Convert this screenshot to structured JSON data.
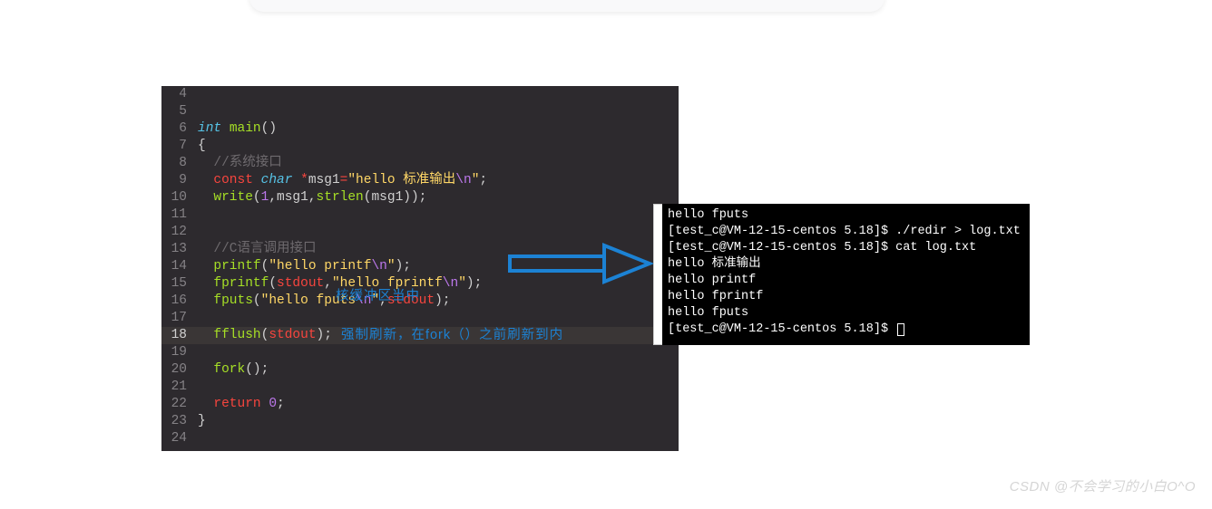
{
  "code": {
    "lines": [
      {
        "n": 4,
        "html": ""
      },
      {
        "n": 5,
        "html": ""
      },
      {
        "n": 6,
        "html": "<span class='type'>int</span> <span class='func'>main</span><span class='punc'>()</span>"
      },
      {
        "n": 7,
        "html": "<span class='punc'>{</span>"
      },
      {
        "n": 8,
        "html": "  <span class='cmt'>//系统接口</span>"
      },
      {
        "n": 9,
        "html": "  <span class='kw'>const</span> <span class='type'>char</span> <span class='kw'>*</span><span class='code'>msg1</span><span class='kw'>=</span><span class='str'>\"hello 标准输出</span><span class='esc'>\\n</span><span class='str'>\"</span><span class='punc'>;</span>"
      },
      {
        "n": 10,
        "html": "  <span class='func'>write</span><span class='punc'>(</span><span class='num'>1</span><span class='punc'>,</span><span class='code'>msg1</span><span class='punc'>,</span><span class='func'>strlen</span><span class='punc'>(</span><span class='code'>msg1</span><span class='punc'>));</span>"
      },
      {
        "n": 11,
        "html": ""
      },
      {
        "n": 12,
        "html": ""
      },
      {
        "n": 13,
        "html": "  <span class='cmt'>//C语言调用接口</span>"
      },
      {
        "n": 14,
        "html": "  <span class='func'>printf</span><span class='punc'>(</span><span class='str'>\"hello printf</span><span class='esc'>\\n</span><span class='str'>\"</span><span class='punc'>);</span>"
      },
      {
        "n": 15,
        "html": "  <span class='func'>fprintf</span><span class='punc'>(</span><span class='const'>stdout</span><span class='punc'>,</span><span class='str'>\"hello fprintf</span><span class='esc'>\\n</span><span class='str'>\"</span><span class='punc'>);</span>"
      },
      {
        "n": 16,
        "html": "  <span class='func'>fputs</span><span class='punc'>(</span><span class='str'>\"hello fputs</span><span class='esc'>\\n</span><span class='str'>\"</span><span class='punc'>,</span><span class='const'>stdout</span><span class='punc'>);</span>"
      },
      {
        "n": 17,
        "html": ""
      },
      {
        "n": 18,
        "html": "  <span class='func'>fflush</span><span class='punc'>(</span><span class='const'>stdout</span><span class='punc'>);</span>",
        "hl": true,
        "annot": "强制刷新，在fork（）之前刷新到内"
      },
      {
        "n": 19,
        "html": ""
      },
      {
        "n": 20,
        "html": "  <span class='func'>fork</span><span class='punc'>();</span>"
      },
      {
        "n": 21,
        "html": ""
      },
      {
        "n": 22,
        "html": "  <span class='kw'>return</span> <span class='num'>0</span><span class='punc'>;</span>"
      },
      {
        "n": 23,
        "html": "<span class='punc'>}</span>"
      },
      {
        "n": 24,
        "html": ""
      }
    ],
    "annot_line2": "核缓冲区当中"
  },
  "terminal": {
    "lines": [
      "hello fputs",
      "[test_c@VM-12-15-centos 5.18]$ ./redir > log.txt",
      "[test_c@VM-12-15-centos 5.18]$ cat log.txt",
      "hello 标准输出",
      "hello printf",
      "hello fprintf",
      "hello fputs",
      "[test_c@VM-12-15-centos 5.18]$ "
    ]
  },
  "watermark": "CSDN @不会学习的小白O^O"
}
